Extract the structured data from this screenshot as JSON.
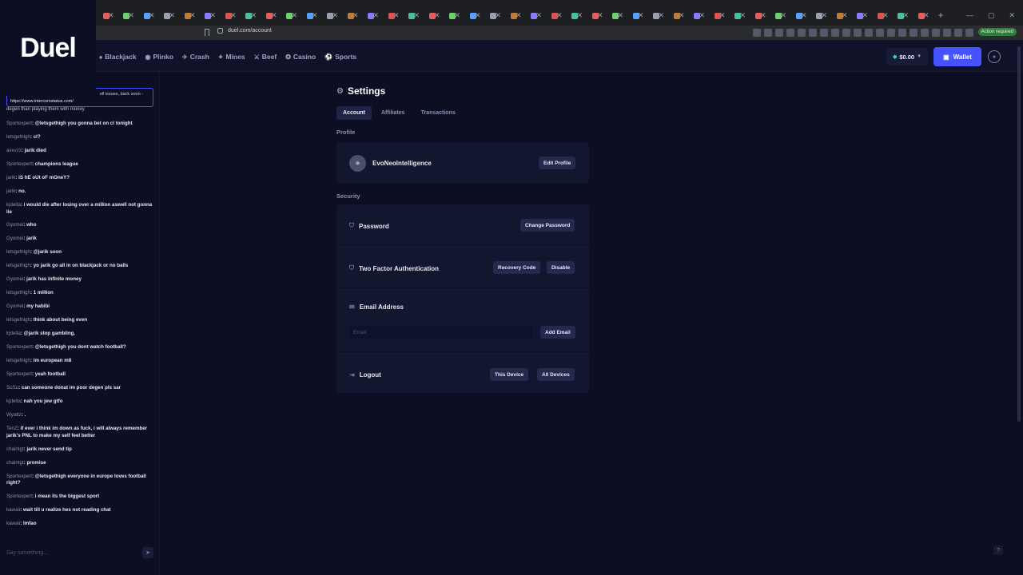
{
  "browser": {
    "url": "duel.com/account",
    "new_tab_symbol": "+",
    "action_required_label": "Action required"
  },
  "logo_text": "Duel",
  "nav": [
    {
      "icon": "blackjack-icon",
      "glyph": "♠",
      "label": "Blackjack"
    },
    {
      "icon": "plinko-icon",
      "glyph": "◉",
      "label": "Plinko"
    },
    {
      "icon": "crash-icon",
      "glyph": "✈",
      "label": "Crash"
    },
    {
      "icon": "mines-icon",
      "glyph": "✦",
      "label": "Mines"
    },
    {
      "icon": "beef-icon",
      "glyph": "⚔",
      "label": "Beef"
    },
    {
      "icon": "casino-icon",
      "glyph": "✪",
      "label": "Casino"
    },
    {
      "icon": "sports-icon",
      "glyph": "⚽",
      "label": "Sports"
    }
  ],
  "header": {
    "balance": "$0.00",
    "wallet_label": "Wallet"
  },
  "chat": {
    "tooltip_link": "https://www.intercomstatus.com/",
    "tooltip_msg": "ell issues, back soon -",
    "partial_line": "degen than playing them with money",
    "messages": [
      {
        "user": "Sportexpert",
        "text": "@letsgethigh you gonna bet on cl tonight"
      },
      {
        "user": "letsgethigh",
        "text": "cl?"
      },
      {
        "user": "avvvzz",
        "text": "jarik died"
      },
      {
        "user": "Sportexpert",
        "text": "champions league"
      },
      {
        "user": "jarik",
        "text": "iS hE oUt oF mOneY?"
      },
      {
        "user": "jarik",
        "text": "no."
      },
      {
        "user": "kjdelta",
        "text": "i would die after losing over a million aswell not gonna lie"
      },
      {
        "user": "Gyomei",
        "text": "who"
      },
      {
        "user": "Gyomei",
        "text": "jarik"
      },
      {
        "user": "letsgethigh",
        "text": "@jarik soon"
      },
      {
        "user": "letsgethigh",
        "text": "yo jarik go all in on blackjack or no balls"
      },
      {
        "user": "Gyomei",
        "text": "jarik has infinite money"
      },
      {
        "user": "letsgethigh",
        "text": "1 million"
      },
      {
        "user": "Gyomei",
        "text": "my habibi"
      },
      {
        "user": "letsgethigh",
        "text": "think about being even"
      },
      {
        "user": "kjdelta",
        "text": "@jarik  stop gambling."
      },
      {
        "user": "Sportexpert",
        "text": "@letsgethigh you dont watch football?"
      },
      {
        "user": "letsgethigh",
        "text": "im european m8"
      },
      {
        "user": "Sportexpert",
        "text": "yeah football"
      },
      {
        "user": "SuSu",
        "text": "can someone donat im poor degen pls sar"
      },
      {
        "user": "kjdelta",
        "text": "nah you jew gtfo"
      },
      {
        "user": "Wyattz",
        "text": "."
      },
      {
        "user": "TenZ",
        "text": "if ever i think im down as fuck, i will always remember jarik's PNL to make my self feel better"
      },
      {
        "user": "chaintgt",
        "text": "jarik never send tip"
      },
      {
        "user": "chaintgt",
        "text": "promise"
      },
      {
        "user": "Sportexpert",
        "text": "@letsgethigh everyone in europe loves football right?"
      },
      {
        "user": "Sportexpert",
        "text": "i mean its the biggest sport"
      },
      {
        "user": "kawaii",
        "text": "wait till u realize hes not reading chat"
      },
      {
        "user": "kawaii",
        "text": "lmfao"
      }
    ],
    "input_placeholder": "Say something..."
  },
  "settings": {
    "title": "Settings",
    "tabs": [
      "Account",
      "Affiliates",
      "Transactions"
    ],
    "profile_label": "Profile",
    "username": "EvoNeoIntelligence",
    "edit_profile": "Edit Profile",
    "security_label": "Security",
    "password_title": "Password",
    "change_password": "Change Password",
    "twofa_title": "Two Factor Authentication",
    "recovery_code": "Recovery Code",
    "disable": "Disable",
    "email_title": "Email Address",
    "email_placeholder": "Email",
    "add_email": "Add Email",
    "logout_title": "Logout",
    "this_device": "This Device",
    "all_devices": "All Devices"
  },
  "colors": {
    "background": "#0c0f24",
    "card": "#12162e",
    "accent": "#4552ff",
    "button": "#242a4d"
  }
}
